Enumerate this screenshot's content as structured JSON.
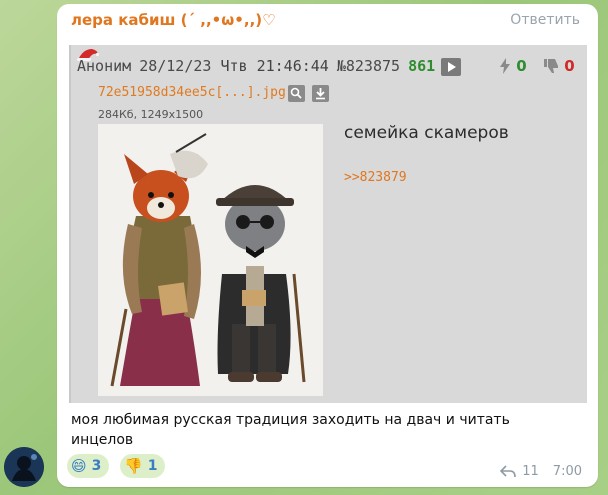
{
  "message": {
    "sender": "лера кабиш (´ ,,•ω•,,)♡",
    "reply_action": "Ответить",
    "text": "моя любимая русская традиция заходить на двач и читать инцелов",
    "reactions": [
      {
        "emoji": "😄",
        "count": "3"
      },
      {
        "emoji": "👎",
        "count": "1"
      }
    ],
    "replies": "11",
    "time": "7:00"
  },
  "post": {
    "author": "Аноним",
    "date": "28/12/23",
    "weekday": "Чтв",
    "time": "21:46:44",
    "number": "№823875",
    "count": "861",
    "likes": "0",
    "dislikes": "0",
    "file_name": "72e51958d34ee5c[...].jpg",
    "file_meta": "284Кб, 1249x1500",
    "text": "семейка скамеров",
    "reply_link": ">>823879"
  },
  "icons": {
    "hat": "santa-hat-icon",
    "play": "play-icon",
    "like": "lightning-icon",
    "dislike": "thumbs-down-icon",
    "search": "search-icon",
    "download": "download-icon",
    "reply": "reply-arrow-icon"
  },
  "colors": {
    "sender": "#e0761f",
    "post_count": "#2f8d2f",
    "likes": "#2f8d2f",
    "dislikes": "#d12828",
    "link": "#e0761f",
    "reaction_bg": "#dcefc9",
    "reaction_count": "#3b7dc4"
  }
}
